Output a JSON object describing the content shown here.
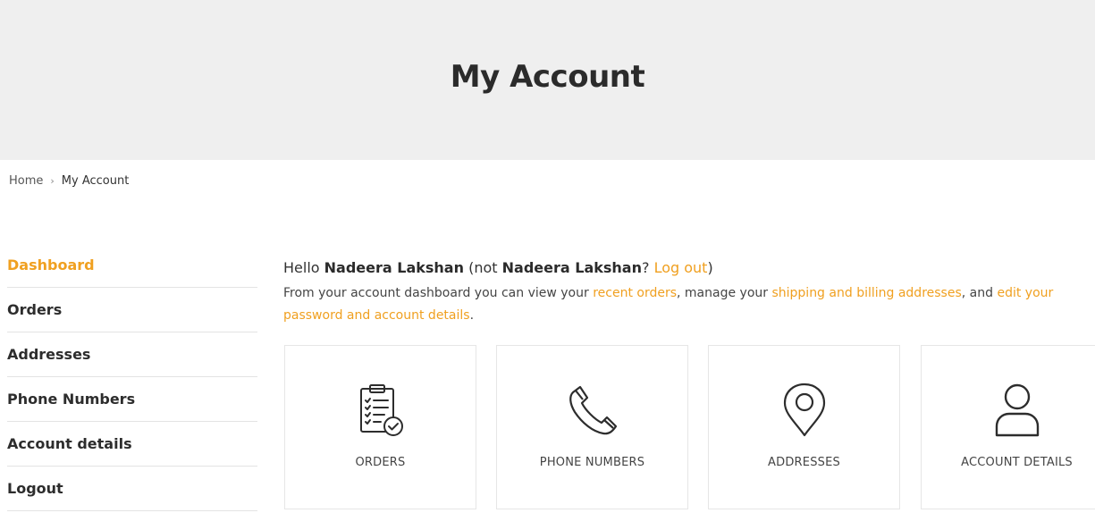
{
  "header": {
    "title": "My Account"
  },
  "breadcrumb": {
    "home": "Home",
    "separator": "›",
    "current": "My Account"
  },
  "sidebar": {
    "items": [
      {
        "label": "Dashboard",
        "active": true
      },
      {
        "label": "Orders"
      },
      {
        "label": "Addresses"
      },
      {
        "label": "Phone Numbers"
      },
      {
        "label": "Account details"
      },
      {
        "label": "Logout"
      }
    ]
  },
  "greeting": {
    "hello": "Hello",
    "user_name": "Nadeera Lakshan",
    "not_prefix": "(not",
    "not_name": "Nadeera Lakshan",
    "question": "?",
    "logout_link": "Log out",
    "close_paren": ")"
  },
  "intro": {
    "part1": "From your account dashboard you can view your ",
    "link_orders": "recent orders",
    "part2": ", manage your ",
    "link_addresses": "shipping and billing addresses",
    "part3": ", and ",
    "link_account": "edit your password and account details",
    "part4": "."
  },
  "cards": [
    {
      "label": "ORDERS",
      "icon": "clipboard-check-icon"
    },
    {
      "label": "PHONE NUMBERS",
      "icon": "phone-icon"
    },
    {
      "label": "ADDRESSES",
      "icon": "map-pin-icon"
    },
    {
      "label": "ACCOUNT DETAILS",
      "icon": "user-icon"
    }
  ],
  "colors": {
    "accent": "#f0a020",
    "hero_bg": "#efefef",
    "text": "#333333"
  }
}
